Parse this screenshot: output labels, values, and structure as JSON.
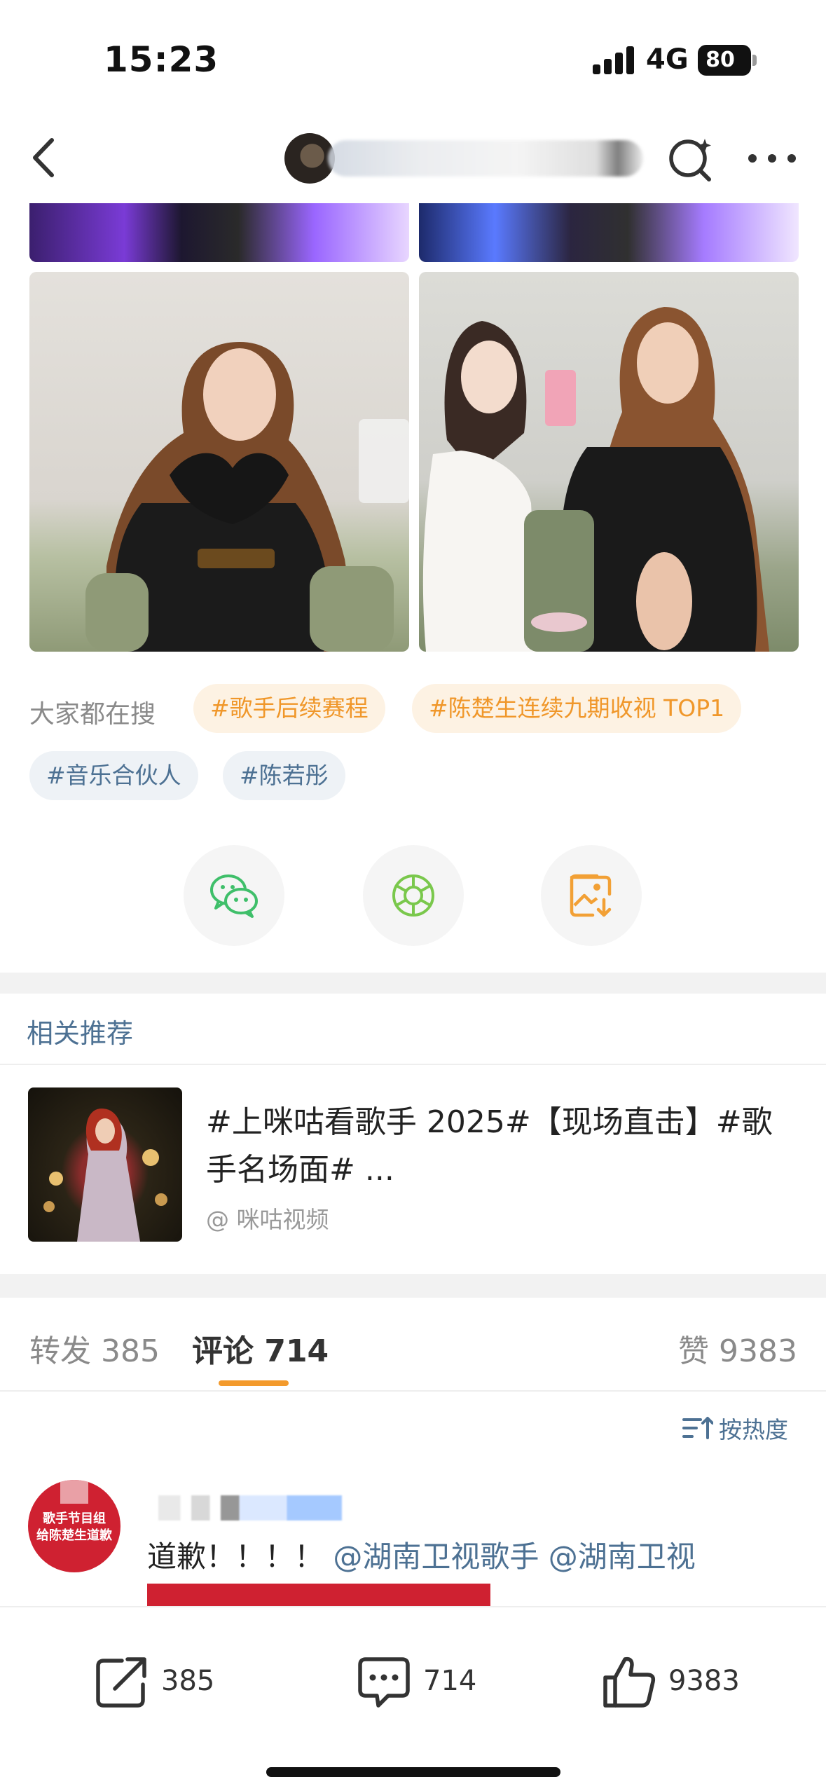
{
  "status_bar": {
    "time": "15:23",
    "network": "4G",
    "battery": "80"
  },
  "nav": {
    "back_icon": "chevron-left-icon",
    "search_icon": "search-sparkle-icon",
    "more_icon": "ellipsis-icon"
  },
  "photos": {
    "top_partial": [
      "stage-photo-left",
      "stage-photo-right"
    ],
    "main": [
      "singer-heart-pose-photo",
      "singer-with-host-photo"
    ]
  },
  "hot_search": {
    "label": "大家都在搜",
    "tags": [
      "#歌手后续赛程",
      "#陈楚生连续九期收视 TOP1",
      "#音乐合伙人",
      "#陈若彤"
    ]
  },
  "share": {
    "icons": [
      "wechat-icon",
      "moments-icon",
      "save-image-icon"
    ]
  },
  "recommend": {
    "title": "相关推荐",
    "item_text": "#上咪咕看歌手 2025#【现场直击】#歌手名场面# ...",
    "item_source": "@ 咪咕视频"
  },
  "comments": {
    "tabs": {
      "repost_label": "转发",
      "repost_count": "385",
      "comment_label": "评论",
      "comment_count": "714",
      "like_label": "赞",
      "like_count": "9383"
    },
    "sort_label": "按热度",
    "first": {
      "avatar_text_1": "歌手节目组",
      "avatar_text_2": "给陈楚生道歉",
      "text": "道歉！！！！",
      "mention_1": "@湖南卫视歌手",
      "mention_2": "@湖南卫视"
    }
  },
  "bottom_bar": {
    "repost": "385",
    "comment": "714",
    "like": "9383"
  },
  "colors": {
    "accent_blue": "#4d7193",
    "accent_orange": "#f0972a",
    "red": "#cf2131"
  }
}
